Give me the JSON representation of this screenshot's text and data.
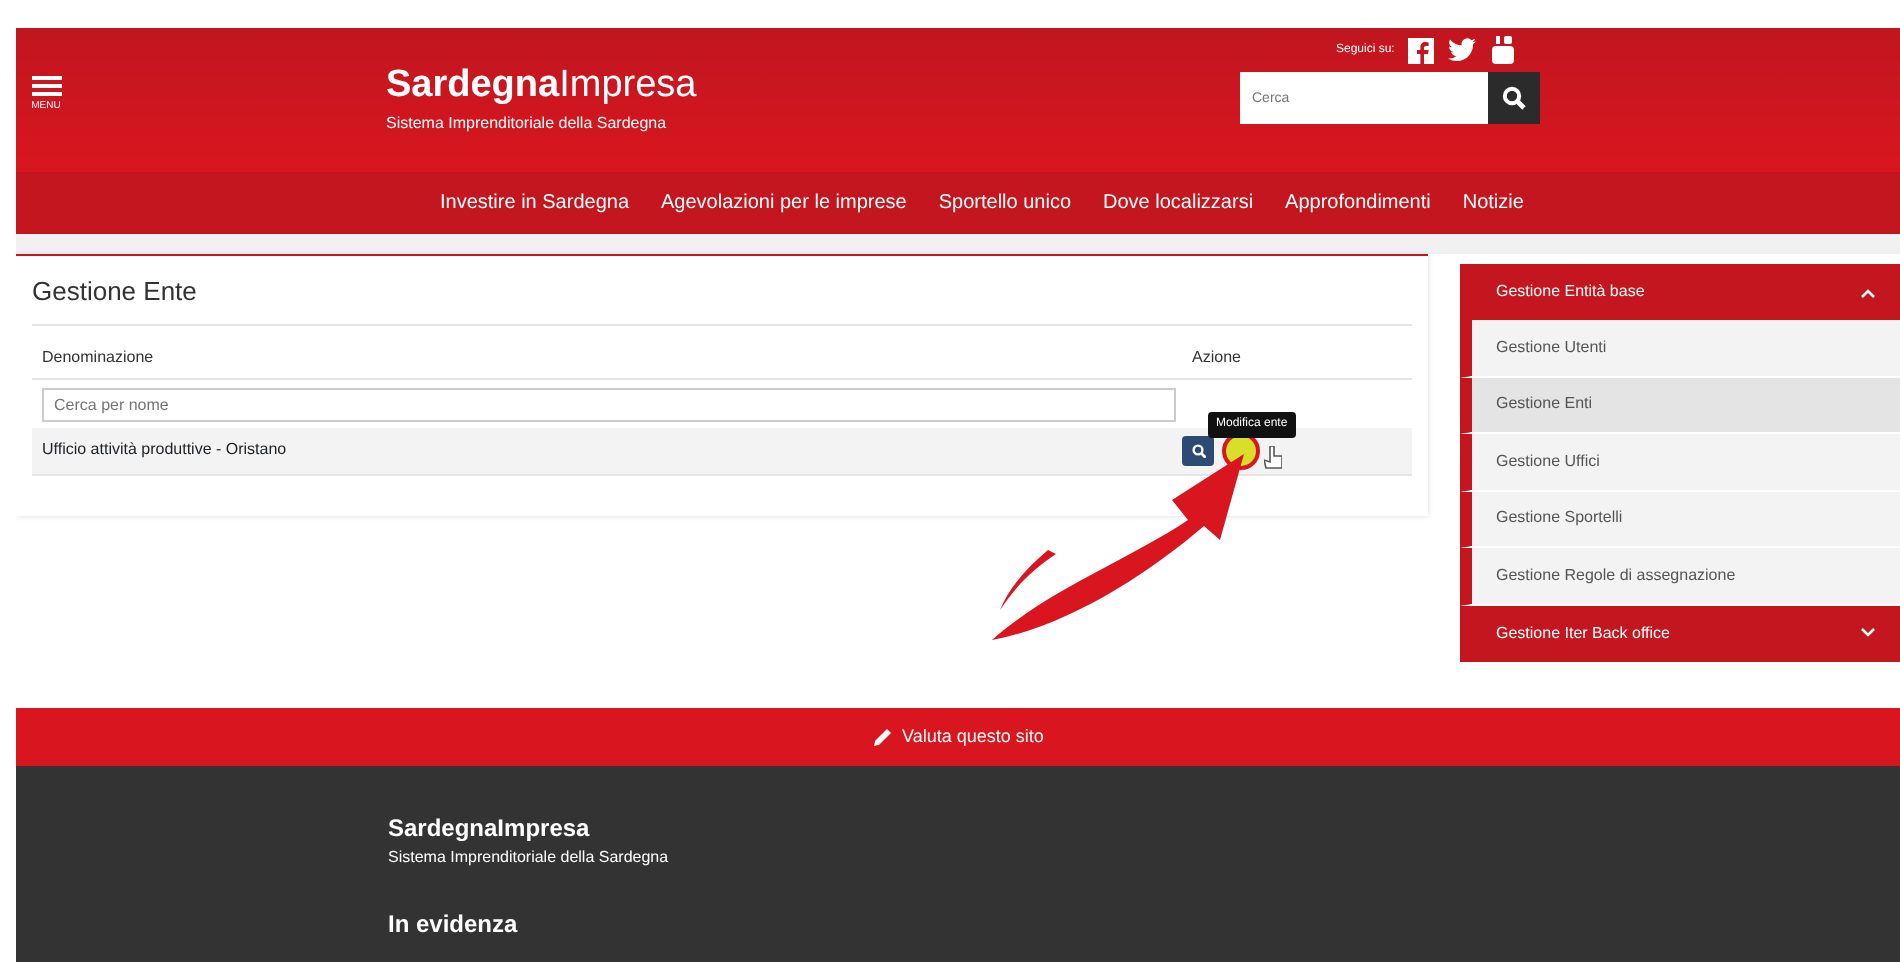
{
  "header": {
    "menu_label": "MENU",
    "logo": "**Sardegna**Impresa",
    "tagline": "Sistema Imprenditoriale della Sardegna",
    "social_label": "Seguici su:",
    "search": {
      "placeholder": "Cerca"
    }
  },
  "nav": [
    "Investire in Sardegna",
    "Agevolazioni per le imprese",
    "Sportello unico",
    "Dove localizzarsi",
    "Approfondimenti",
    "Notizie"
  ],
  "panel": {
    "title": "Gestione Ente",
    "columns": [
      "Denominazione",
      "Azione"
    ],
    "filter": {
      "placeholder": "Cerca per nome"
    },
    "rows": [
      {
        "name": "Ufficio attività produttive - Oristano",
        "tooltip": "Modifica ente",
        "highlighted": true
      }
    ]
  },
  "sidebar": [
    {
      "label": "Gestione Entità base",
      "expanded": true,
      "items": [
        {
          "label": "Gestione Utenti",
          "selected": false
        },
        {
          "label": "Gestione Enti",
          "selected": true
        },
        {
          "label": "Gestione Uffici",
          "selected": false
        },
        {
          "label": "Gestione Sportelli",
          "selected": false
        },
        {
          "label": "Gestione Regole di assegnazione",
          "selected": false
        }
      ]
    },
    {
      "label": "Gestione Iter Back office",
      "expanded": false
    }
  ],
  "footer": {
    "rate_label": "Valuta questo sito",
    "brand": "SardegnaImpresa",
    "tagline": "Sistema Imprenditoriale della Sardegna",
    "heading": "In evidenza"
  }
}
